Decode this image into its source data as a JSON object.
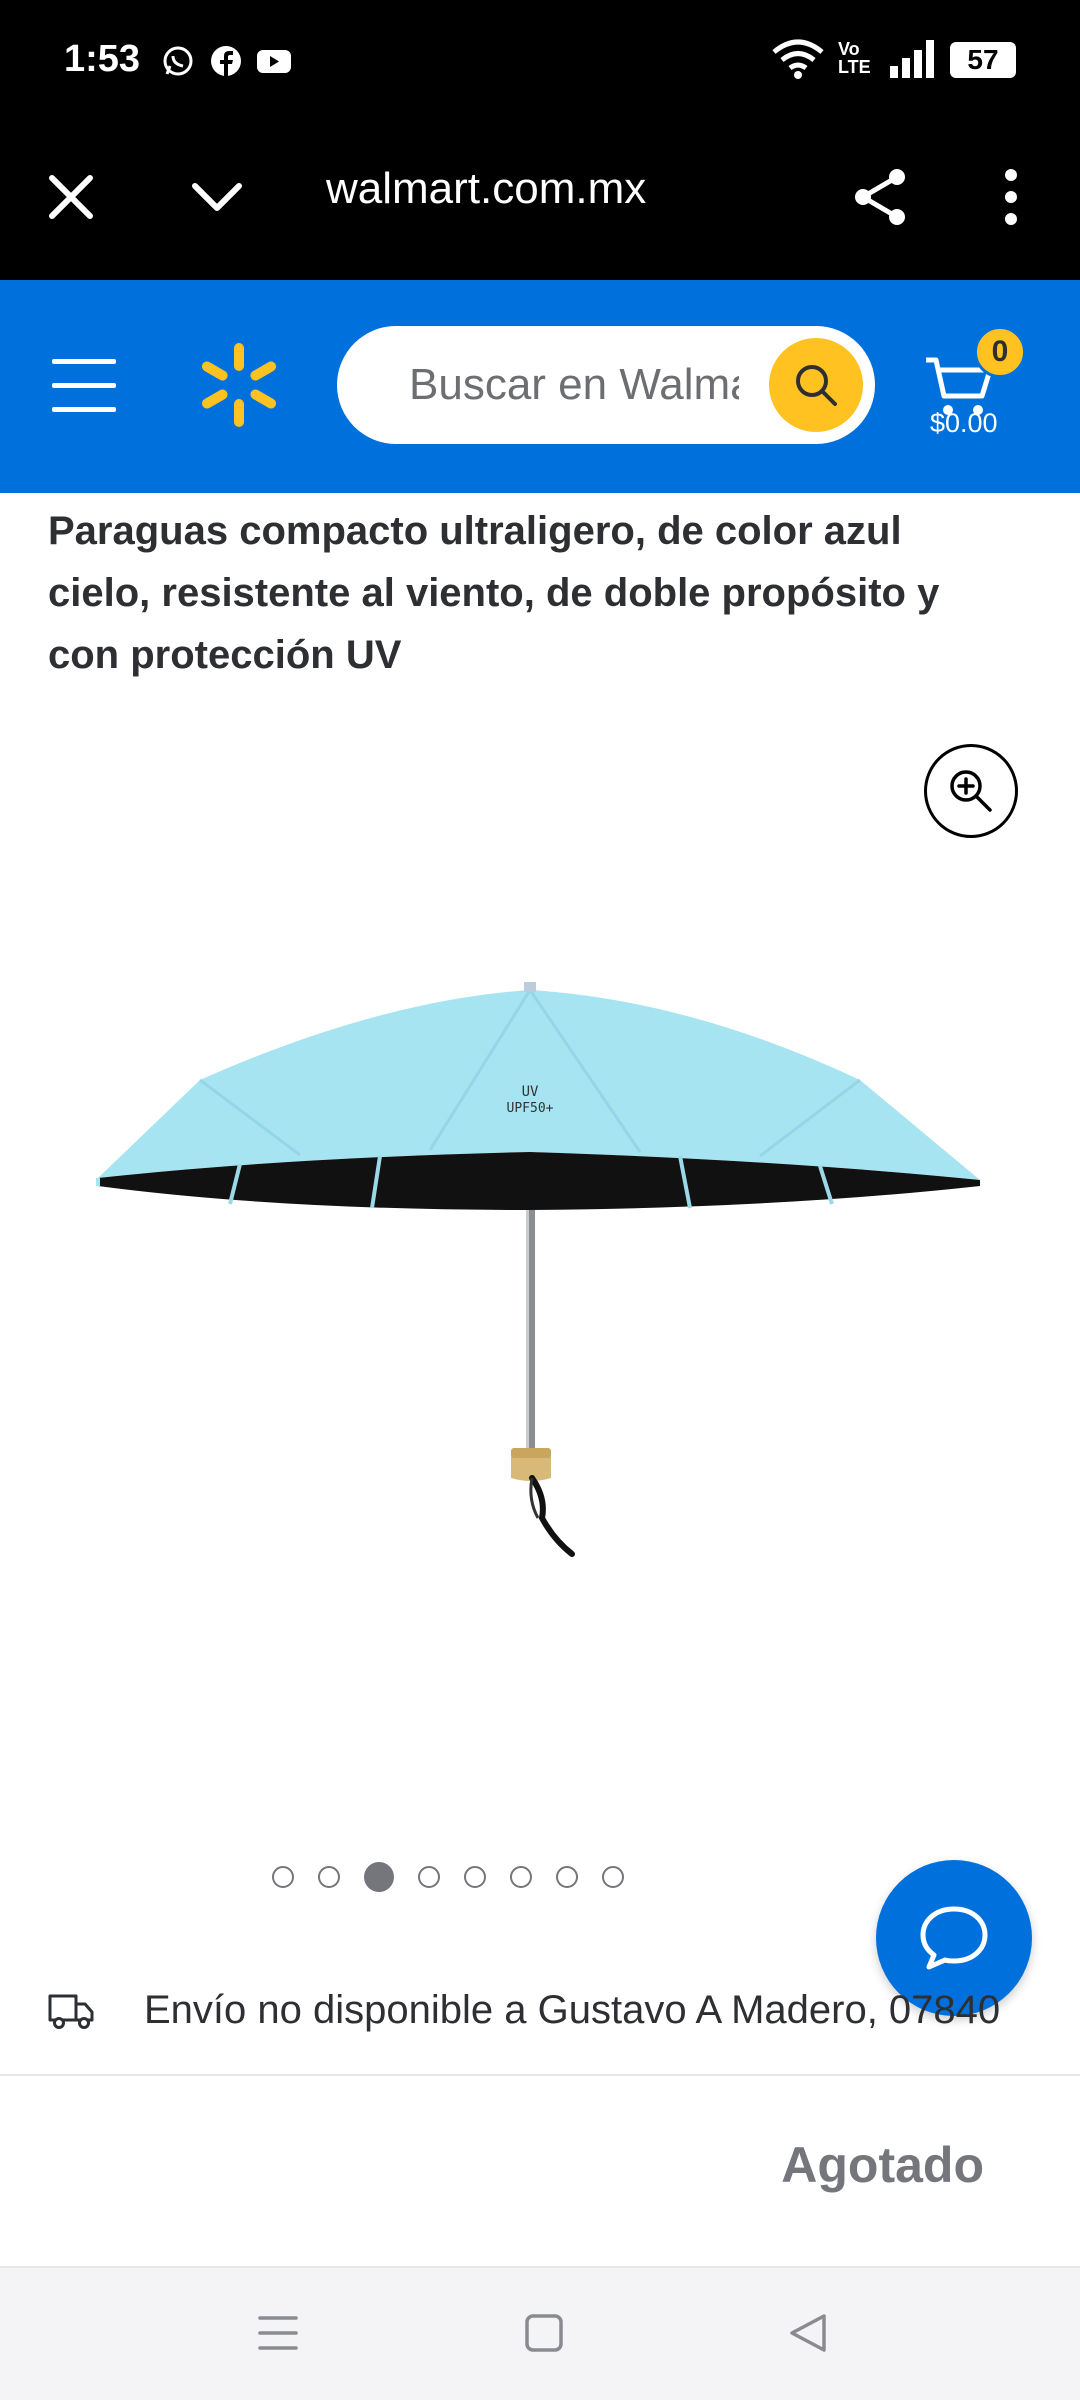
{
  "status_bar": {
    "time": "1:53",
    "apps": [
      "whatsapp-icon",
      "facebook-icon",
      "youtube-icon"
    ],
    "signal_label": "Vo LTE",
    "battery": "57"
  },
  "browser": {
    "url": "walmart.com.mx",
    "icons": [
      "close-icon",
      "chevron-down-icon",
      "share-icon",
      "more-vert-icon"
    ]
  },
  "header": {
    "search_placeholder": "Buscar en Walmart",
    "cart_count": "0",
    "cart_total": "$0.00",
    "colors": {
      "brand_blue": "#0071dc",
      "spark_yellow": "#ffc220"
    }
  },
  "product": {
    "title": "Paraguas compacto ultraligero, de color azul cielo, resistente al viento, de doble propósito y con protección UV",
    "image_text": "UV UPF50+",
    "image_count": 8,
    "active_image": 3
  },
  "shipping": {
    "text": "Envío no disponible a Gustavo A Madero, 07840"
  },
  "availability": {
    "status": "Agotado"
  }
}
